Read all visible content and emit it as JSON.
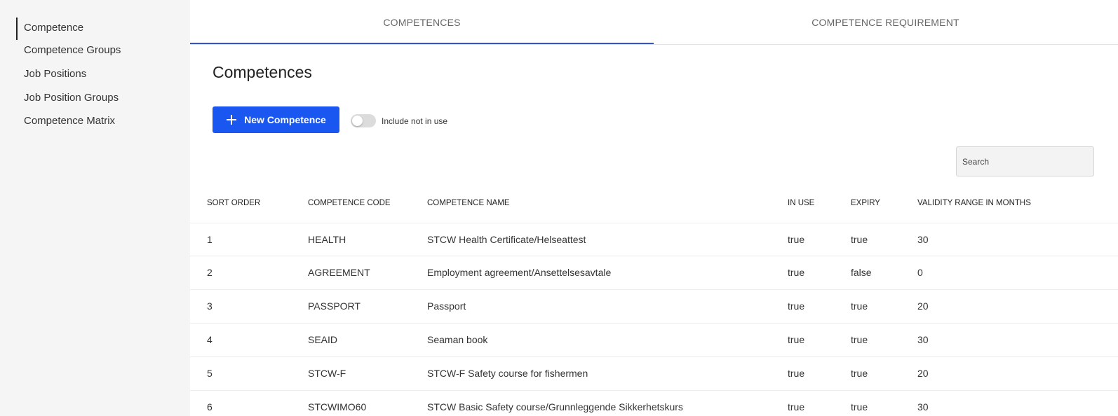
{
  "sidebar": {
    "items": [
      {
        "label": "Competence"
      },
      {
        "label": "Competence Groups"
      },
      {
        "label": "Job Positions"
      },
      {
        "label": "Job Position Groups"
      },
      {
        "label": "Competence Matrix"
      }
    ]
  },
  "tabs": [
    {
      "label": "COMPETENCES"
    },
    {
      "label": "COMPETENCE REQUIREMENT"
    }
  ],
  "page": {
    "title": "Competences",
    "new_button_label": "New Competence",
    "toggle_label": "Include not in use",
    "search_placeholder": "Search"
  },
  "table": {
    "headers": [
      "SORT ORDER",
      "COMPETENCE CODE",
      "COMPETENCE NAME",
      "IN USE",
      "EXPIRY",
      "VALIDITY RANGE IN MONTHS"
    ],
    "rows": [
      [
        "1",
        "HEALTH",
        "STCW Health Certificate/Helseattest",
        "true",
        "true",
        "30"
      ],
      [
        "2",
        "AGREEMENT",
        "Employment agreement/Ansettelsesavtale",
        "true",
        "false",
        "0"
      ],
      [
        "3",
        "PASSPORT",
        "Passport",
        "true",
        "true",
        "20"
      ],
      [
        "4",
        "SEAID",
        "Seaman book",
        "true",
        "true",
        "30"
      ],
      [
        "5",
        "STCW-F",
        "STCW-F Safety course for fishermen",
        "true",
        "true",
        "20"
      ],
      [
        "6",
        "STCWIMO60",
        "STCW Basic Safety course/Grunnleggende Sikkerhetskurs",
        "true",
        "true",
        "30"
      ]
    ]
  },
  "colors": {
    "accent": "#1a56f0",
    "tab_indicator": "#3355cc",
    "sidebar_bg": "#f5f5f5"
  },
  "icons": {
    "new_button": "plus-icon"
  }
}
